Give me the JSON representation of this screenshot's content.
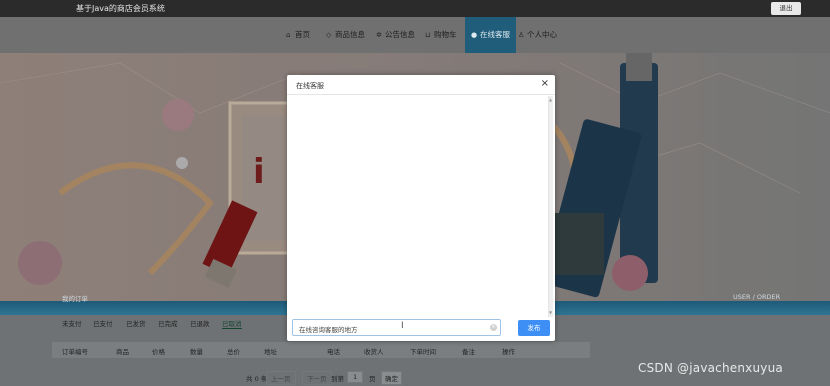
{
  "topbar": {
    "site_title": "基于Java的商店会员系统",
    "logout_label": "退出"
  },
  "nav": {
    "items": [
      {
        "label": "首页",
        "icon": "home-icon"
      },
      {
        "label": "商品信息",
        "icon": "tag-icon"
      },
      {
        "label": "公告信息",
        "icon": "gear-icon"
      },
      {
        "label": "购物车",
        "icon": "cart-icon"
      },
      {
        "label": "在线客服",
        "icon": "chat-icon",
        "active": true
      },
      {
        "label": "个人中心",
        "icon": "user-icon"
      }
    ]
  },
  "orders": {
    "section_title": "我的订单",
    "section_subtitle": "USER / ORDER",
    "status_tabs": [
      "未支付",
      "已支付",
      "已发货",
      "已完成",
      "已退款",
      "已取消"
    ],
    "columns": [
      "订单编号",
      "商品",
      "价格",
      "数量",
      "总价",
      "地址",
      "电话",
      "收货人",
      "下单时间",
      "备注",
      "操作"
    ],
    "pagination": {
      "total": "共 0 条",
      "prev": "上一页",
      "next": "下一页",
      "goto": "到第",
      "page": "1",
      "page_unit": "页",
      "confirm": "确定"
    }
  },
  "modal": {
    "title": "在线客服",
    "close": "×",
    "input_value": "在线咨询客服的地方",
    "publish_label": "发布"
  },
  "watermark": "CSDN @javachenxuyua",
  "colors": {
    "accent": "#1f5d7a",
    "publish": "#3d8ff5"
  }
}
